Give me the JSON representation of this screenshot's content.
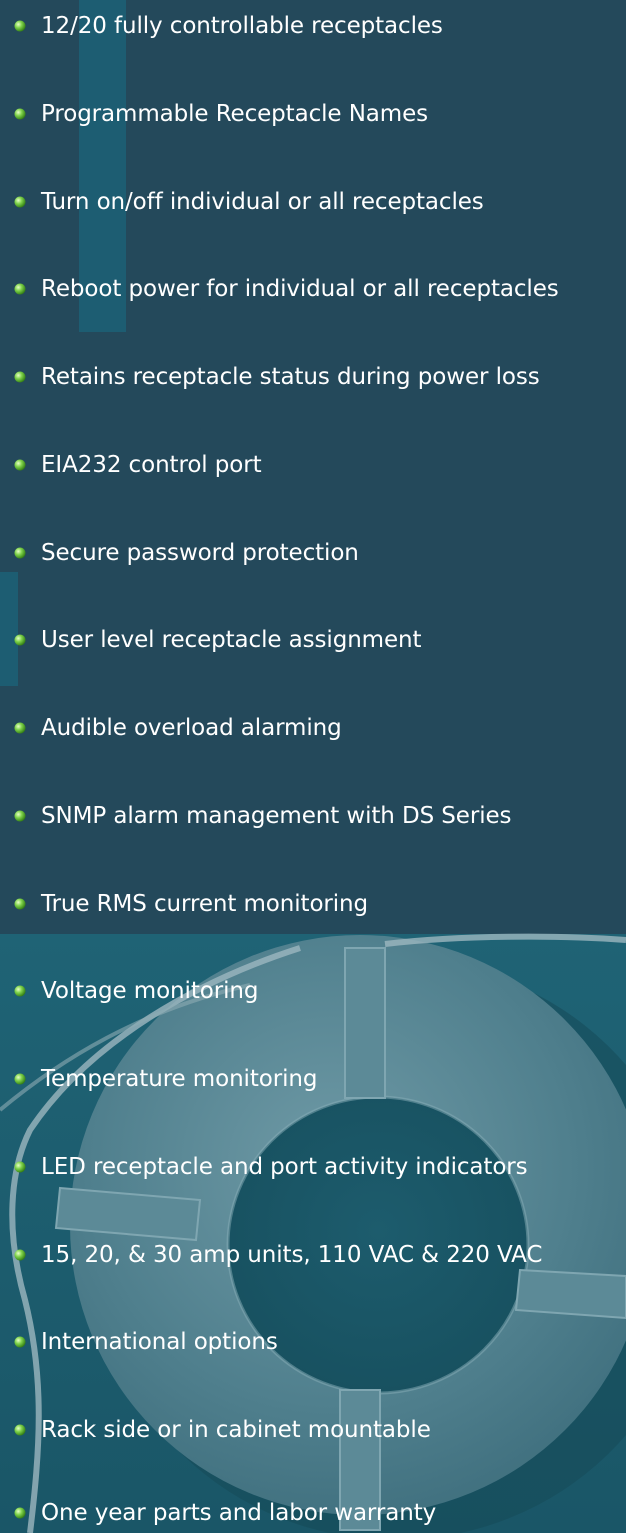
{
  "features": [
    "12/20 fully controllable receptacles",
    "Programmable Receptacle Names",
    "Turn on/off individual or all receptacles",
    "Reboot power for individual or all receptacles",
    "Retains receptacle status during power loss",
    "EIA232 control port",
    "Secure password protection",
    "User level receptacle assignment",
    "Audible overload alarming",
    "SNMP alarm management with DS Series",
    "True RMS current monitoring",
    "Voltage monitoring",
    "Temperature monitoring",
    "LED receptacle and port activity indicators",
    "15, 20, & 30 amp units, 110 VAC & 220 VAC",
    "International options",
    "Rack side or in cabinet mountable",
    "One year parts and labor warranty"
  ],
  "colors": {
    "background_top": "#24495b",
    "background_bottom": "#1f6070",
    "text": "#ffffff",
    "bullet": "#7ed24a"
  },
  "icons": {
    "bullet": "green-sphere-icon",
    "decoration": "life-ring-image"
  }
}
